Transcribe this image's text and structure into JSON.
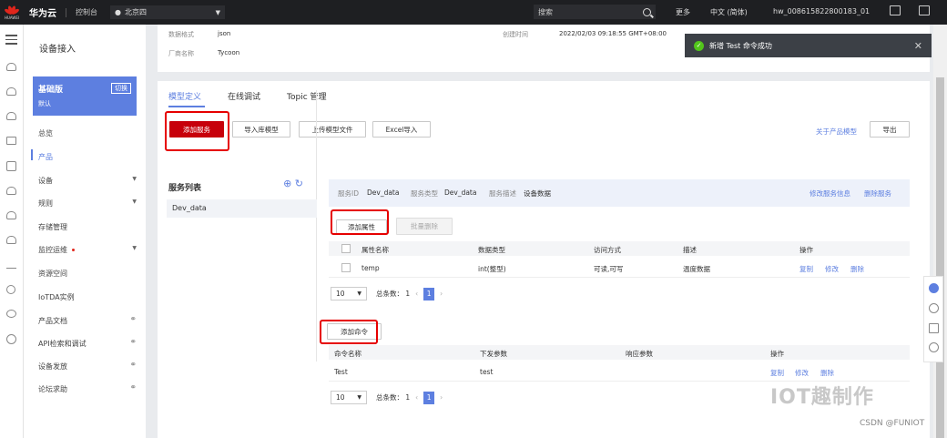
{
  "topbar": {
    "logo_text": "HUAWEI",
    "brand": "华为云",
    "console": "控制台",
    "region": "北京四",
    "search_placeholder": "搜索",
    "more": "更多",
    "language": "中文 (简体)",
    "account": "hw_008615822800183_01"
  },
  "sidebar": {
    "title": "设备接入",
    "plan_title": "基础版",
    "plan_sub": "默认",
    "plan_switch": "切换",
    "items": [
      {
        "label": "总览"
      },
      {
        "label": "产品"
      },
      {
        "label": "设备"
      },
      {
        "label": "规则"
      },
      {
        "label": "存储管理"
      },
      {
        "label": "监控运维"
      },
      {
        "label": "资源空间"
      },
      {
        "label": "IoTDA实例"
      },
      {
        "label": "产品文档"
      },
      {
        "label": "API检索和调试"
      },
      {
        "label": "设备发放"
      },
      {
        "label": "论坛求助"
      }
    ]
  },
  "info": {
    "data_format_label": "数据格式",
    "data_format_value": "json",
    "manufacturer_label": "厂商名称",
    "manufacturer_value": "Tycoon",
    "created_label": "创建时间",
    "created_value": "2022/02/03 09:18:55 GMT+08:00"
  },
  "toast": {
    "message": "新增 Test 命令成功"
  },
  "tabs": [
    "模型定义",
    "在线调试",
    "Topic 管理"
  ],
  "toolbar": {
    "add_service": "添加服务",
    "import_model": "导入库模型",
    "upload_model": "上传模型文件",
    "excel_import": "Excel导入",
    "about_model": "关于产品模型",
    "export": "导出"
  },
  "service_list": {
    "title": "服务列表",
    "items": [
      "Dev_data"
    ]
  },
  "service_info": {
    "id_label": "服务ID",
    "id_value": "Dev_data",
    "type_label": "服务类型",
    "type_value": "Dev_data",
    "desc_label": "服务描述",
    "desc_value": "设备数据",
    "edit": "修改服务信息",
    "delete": "删除服务"
  },
  "properties": {
    "add": "添加属性",
    "batch_delete": "批量删除",
    "headers": [
      "属性名称",
      "数据类型",
      "访问方式",
      "描述",
      "操作"
    ],
    "rows": [
      {
        "name": "temp",
        "type": "int(整型)",
        "access": "可读,可写",
        "desc": "温度数据",
        "op1": "复制",
        "op2": "修改",
        "op3": "删除"
      }
    ],
    "page_size": "10",
    "total": "总条数： 1",
    "page": "1"
  },
  "commands": {
    "add": "添加命令",
    "headers": [
      "命令名称",
      "下发参数",
      "响应参数",
      "操作"
    ],
    "rows": [
      {
        "name": "Test",
        "param": "test",
        "resp": "",
        "op1": "复制",
        "op2": "修改",
        "op3": "删除"
      }
    ],
    "page_size": "10",
    "total": "总条数： 1",
    "page": "1"
  },
  "watermark": "IOT趣制作",
  "csdn": "CSDN @FUNIOT",
  "colors": {
    "accent": "#5d7fe0",
    "brand_red": "#c7000b",
    "highlight": "#e60000"
  }
}
